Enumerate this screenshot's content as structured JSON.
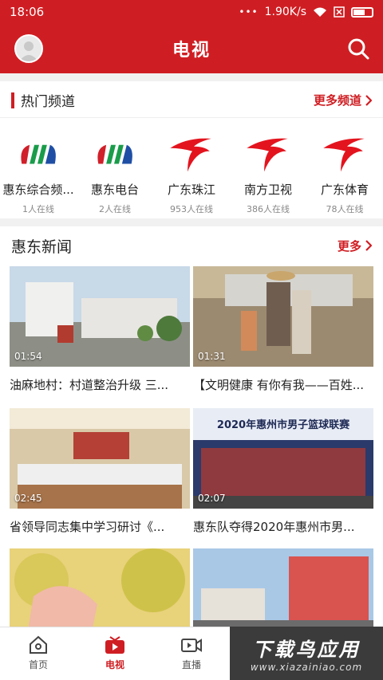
{
  "status": {
    "time": "18:06",
    "dots": "•••",
    "speed": "1.90K/s"
  },
  "nav": {
    "title": "电视"
  },
  "hot": {
    "title": "热门频道",
    "more": "更多频道",
    "channels": [
      {
        "name": "惠东综合频...",
        "online": "1人在线",
        "logo": "hd-logo"
      },
      {
        "name": "惠东电台",
        "online": "2人在线",
        "logo": "hd-logo"
      },
      {
        "name": "广东珠江",
        "online": "953人在线",
        "logo": "gd-logo"
      },
      {
        "name": "南方卫视",
        "online": "386人在线",
        "logo": "gd-logo"
      },
      {
        "name": "广东体育",
        "online": "78人在线",
        "logo": "gd-logo"
      }
    ]
  },
  "news": {
    "title": "惠东新闻",
    "more": "更多",
    "items": [
      {
        "duration": "01:54",
        "caption": "油麻地村：村道整治升级 三..."
      },
      {
        "duration": "01:31",
        "caption": "【文明健康 有你有我——百姓..."
      },
      {
        "duration": "02:45",
        "caption": "省领导同志集中学习研讨《..."
      },
      {
        "duration": "02:07",
        "caption": "惠东队夺得2020年惠州市男...",
        "overlay": "2020年惠州市男子篮球联赛"
      },
      {
        "duration": "",
        "caption": ""
      },
      {
        "duration": "",
        "caption": ""
      }
    ]
  },
  "tabs": [
    {
      "label": "首页",
      "icon": "home-icon"
    },
    {
      "label": "电视",
      "icon": "tv-icon",
      "active": true
    },
    {
      "label": "直播",
      "icon": "live-camera-icon"
    },
    {
      "label": "",
      "icon": ""
    },
    {
      "label": "",
      "icon": ""
    }
  ],
  "watermark": {
    "main": "下载鸟应用",
    "url": "www.xiazainiao.com"
  },
  "colors": {
    "brand": "#cf1e23"
  }
}
